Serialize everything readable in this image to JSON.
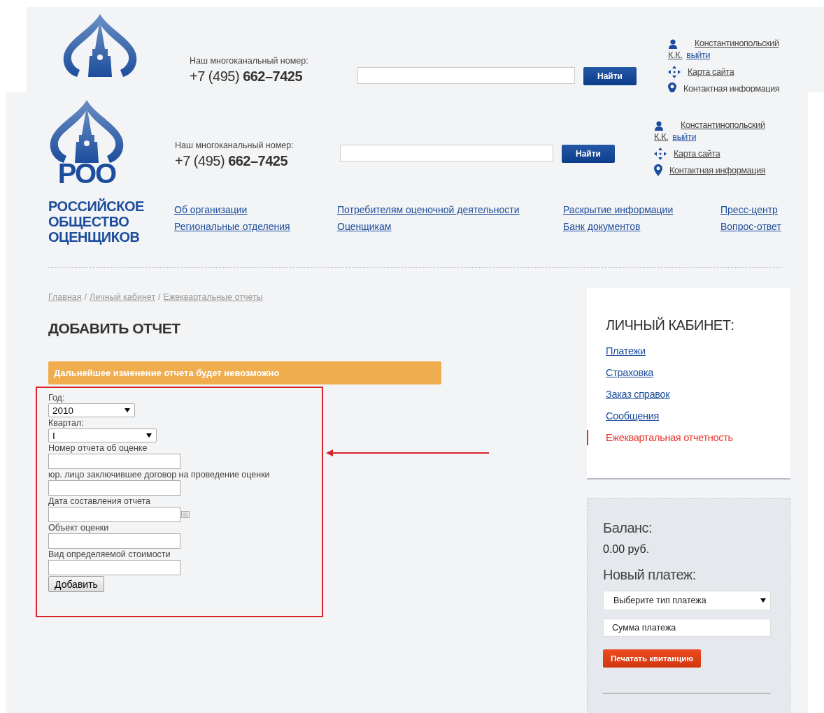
{
  "background_page": {
    "phone_label": "Наш многоканальный номер:",
    "phone_prefix": "+7 (495)",
    "phone_number": "662–7425",
    "search_button": "Найти",
    "user_name": [
      "Константинопольский",
      "К.К."
    ],
    "logout": "выйти",
    "links": [
      "Карта сайта",
      "Контактная информация"
    ]
  },
  "page": {
    "header": {
      "logo_text": "РОО",
      "org_name": "РОССИЙСКОЕ ОБЩЕСТВО ОЦЕНЩИКОВ",
      "phone_label": "Наш многоканальный номер:",
      "phone_prefix": "+7 (495)",
      "phone_number": "662–7425",
      "search_button": "Найти",
      "user_name": [
        "Константинопольский",
        "К.К."
      ],
      "logout": "выйти",
      "links": [
        "Карта сайта",
        "Контактная информация"
      ]
    },
    "nav": [
      {
        "links": [
          "Об организации",
          "Региональные отделения"
        ]
      },
      {
        "links": [
          "Потребителям оценочной деятельности",
          "Оценщикам"
        ]
      },
      {
        "links": [
          "Раскрытие информации",
          "Банк документов"
        ]
      },
      {
        "links": [
          "Пресс-центр",
          "Вопрос-ответ"
        ]
      }
    ],
    "breadcrumbs": {
      "separator": "/",
      "items": [
        "Главная",
        "Личный кабинет",
        "Ежеквартальные отчеты"
      ]
    },
    "title": "ДОБАВИТЬ ОТЧЕТ",
    "warning": "Дальнейшее изменение отчета будет невозможно",
    "form": {
      "fields": [
        {
          "kind": "select",
          "label": "Год:",
          "value": "2010"
        },
        {
          "kind": "select",
          "label": "Квартал:",
          "value": "I"
        },
        {
          "kind": "text",
          "label": "Номер отчета об оценке"
        },
        {
          "kind": "text",
          "label": "юр. лицо заключившее договор на проведение оценки"
        },
        {
          "kind": "date",
          "label": "Дата составления отчета"
        },
        {
          "kind": "text",
          "label": "Объект оценки"
        },
        {
          "kind": "text",
          "label": "Вид определяемой стоимости"
        }
      ],
      "submit": "Добавить"
    },
    "sidebar": {
      "title": "ЛИЧНЫЙ КАБИНЕТ:",
      "items": [
        {
          "label": "Платежи",
          "selected": false
        },
        {
          "label": "Страховка",
          "selected": false
        },
        {
          "label": "Заказ справок",
          "selected": false
        },
        {
          "label": "Сообщения",
          "selected": false
        },
        {
          "label": "Ежеквартальная отчетность",
          "selected": true
        }
      ]
    },
    "balance": {
      "label": "Баланс:",
      "amount": "0.00 руб.",
      "new_payment_label": "Новый платеж:",
      "payment_type": "Выберите тип платежа",
      "amount_placeholder": "Сумма платежа",
      "print_button": "Печатать квитанцию"
    }
  }
}
